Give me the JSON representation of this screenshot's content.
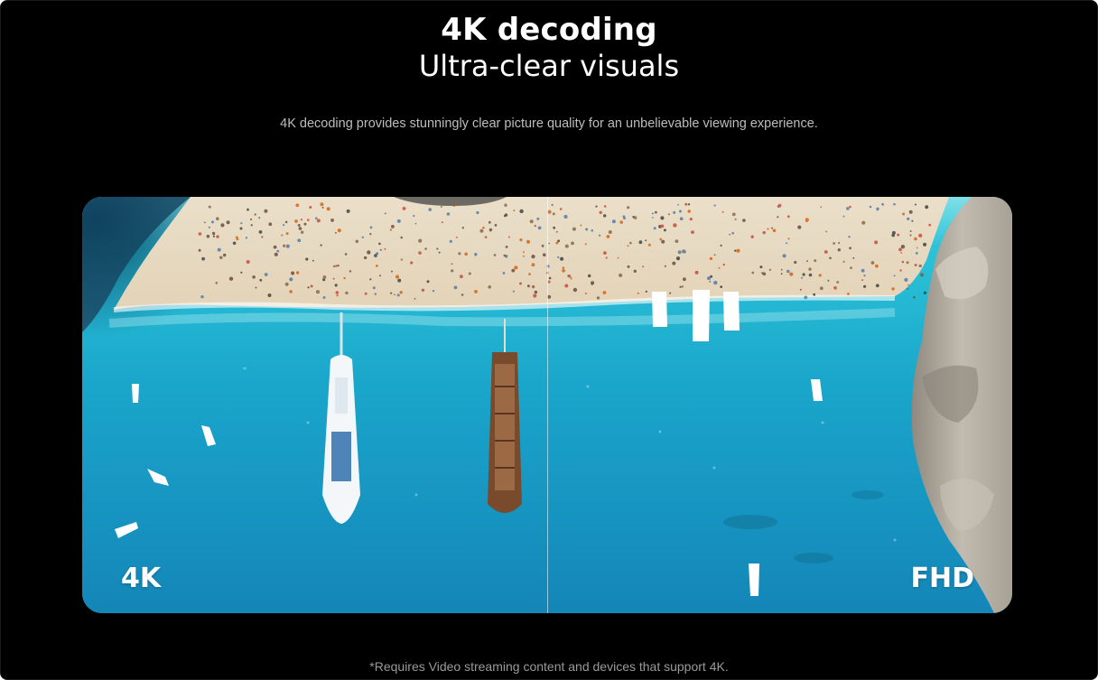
{
  "hero": {
    "title": "4K decoding",
    "subtitle": "Ultra-clear visuals",
    "description": "4K decoding provides stunningly clear picture quality for an unbelievable viewing experience."
  },
  "comparison": {
    "left_label": "4K",
    "right_label": "FHD"
  },
  "footnote": "*Requires Video streaming content and devices that support 4K.",
  "colors": {
    "background": "#000000",
    "heading": "#ffffff",
    "body_text": "#bdbdbd",
    "footnote_text": "#9a9a9a",
    "sea": "#1fa7c9",
    "sand": "#e9dcc6",
    "cliff": "#b9b3a8"
  }
}
